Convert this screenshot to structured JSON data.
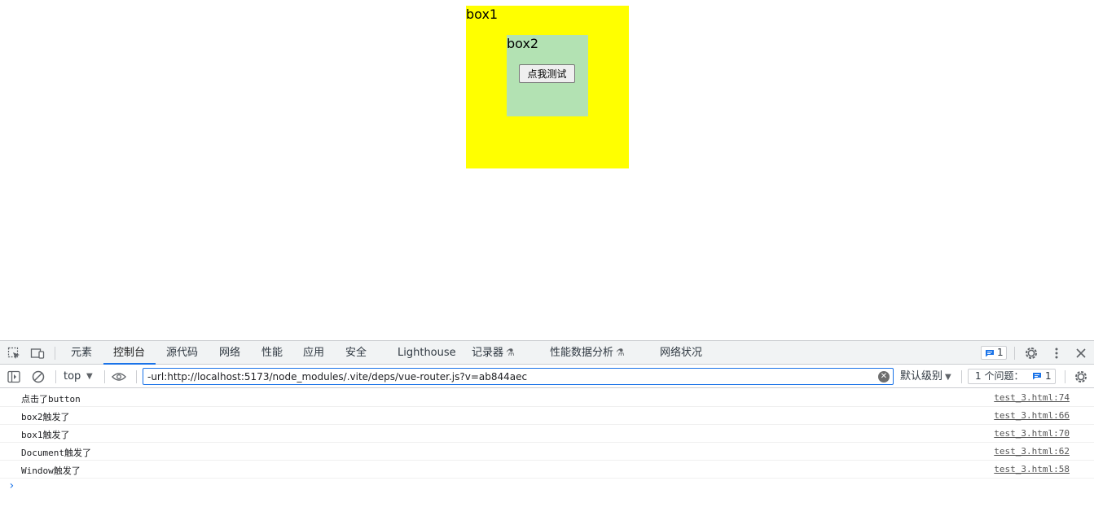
{
  "page": {
    "box1_label": "box1",
    "box2_label": "box2",
    "button_label": "点我测试"
  },
  "devtools": {
    "toolbar_icons": [
      "inspect-element-icon",
      "device-toggle-icon"
    ],
    "tabs": [
      {
        "label": "元素"
      },
      {
        "label": "控制台"
      },
      {
        "label": "源代码"
      },
      {
        "label": "网络"
      },
      {
        "label": "性能"
      },
      {
        "label": "应用"
      },
      {
        "label": "安全"
      },
      {
        "label": "Lighthouse"
      },
      {
        "label": "记录器"
      },
      {
        "label": "性能数据分析"
      },
      {
        "label": "网络状况"
      }
    ],
    "active_tab": "控制台",
    "issue_badge_count": "1",
    "filter_bar": {
      "context": "top",
      "filter_value": "-url:http://localhost:5173/node_modules/.vite/deps/vue-router.js?v=ab844aec",
      "level": "默认级别",
      "issues_label": "1 个问题：",
      "issues_count": "1"
    },
    "console_rows": [
      {
        "message": "点击了button",
        "source": "test_3.html:74"
      },
      {
        "message": "box2触发了",
        "source": "test_3.html:66"
      },
      {
        "message": "box1触发了",
        "source": "test_3.html:70"
      },
      {
        "message": "Document触发了",
        "source": "test_3.html:62"
      },
      {
        "message": "Window触发了",
        "source": "test_3.html:58"
      }
    ],
    "prompt_symbol": "›"
  },
  "colors": {
    "box1_bg": "#ffff00",
    "box2_bg": "#b3e2b3",
    "accent": "#1a73e8"
  }
}
